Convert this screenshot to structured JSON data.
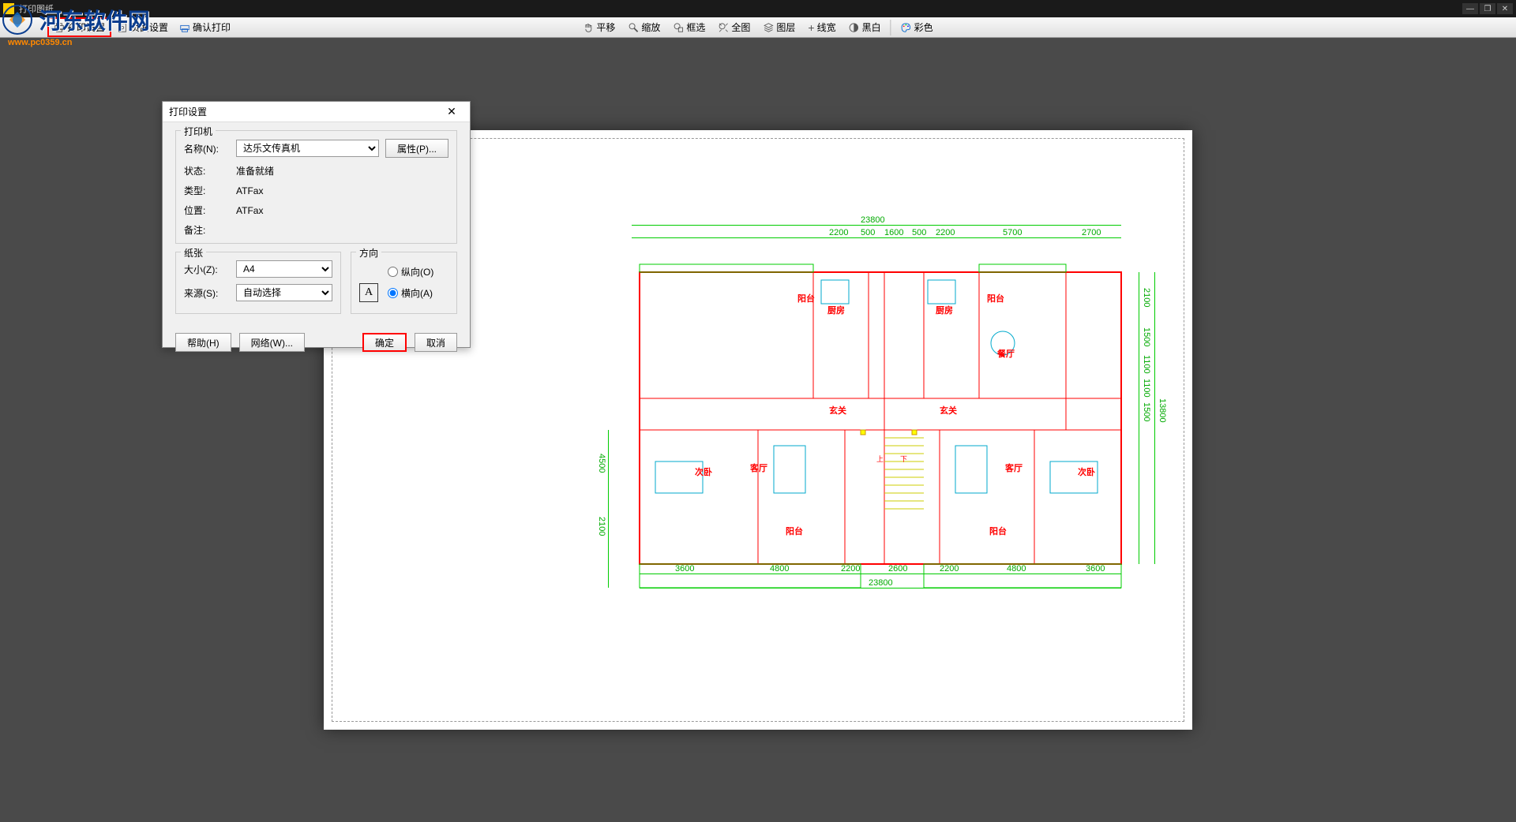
{
  "app": {
    "title": "打印图纸"
  },
  "watermark": {
    "text": "河东软件网",
    "url": "www.pc0359.cn"
  },
  "toolbar": {
    "print_settings": "打印设置",
    "page_settings": "页面设置",
    "confirm_print": "确认打印",
    "pan": "平移",
    "zoom": "缩放",
    "window": "框选",
    "extents": "全图",
    "layers": "图层",
    "lineweight": "线宽",
    "blackwhite": "黑白",
    "color": "彩色"
  },
  "dialog": {
    "title": "打印设置",
    "printer_group": "打印机",
    "name_label": "名称(N):",
    "name_value": "达乐文传真机",
    "properties_btn": "属性(P)...",
    "status_label": "状态:",
    "status_value": "准备就绪",
    "type_label": "类型:",
    "type_value": "ATFax",
    "location_label": "位置:",
    "location_value": "ATFax",
    "comment_label": "备注:",
    "comment_value": "",
    "paper_group": "纸张",
    "size_label": "大小(Z):",
    "size_value": "A4",
    "source_label": "来源(S):",
    "source_value": "自动选择",
    "orient_group": "方向",
    "portrait": "纵向(O)",
    "landscape": "横向(A)",
    "help_btn": "帮助(H)",
    "network_btn": "网络(W)...",
    "ok_btn": "确定",
    "cancel_btn": "取消"
  },
  "plan": {
    "dims_top_total": "23800",
    "dims_top": [
      "2200",
      "500",
      "1600",
      "500",
      "2200",
      "5700",
      "2700"
    ],
    "dims_bottom_total": "23800",
    "dims_bottom": [
      "3600",
      "4800",
      "2200",
      "2600",
      "2200",
      "4800",
      "3600"
    ],
    "dims_right": [
      "2100",
      "1500",
      "1100",
      "1100",
      "1500",
      "13800"
    ],
    "dims_left": [
      "4500",
      "2100"
    ],
    "rooms": {
      "balcony1": "阳台",
      "balcony2": "阳台",
      "balcony3": "阳台",
      "balcony4": "阳台",
      "kitchen1": "厨房",
      "kitchen2": "厨房",
      "dining": "餐厅",
      "dining2": "厅",
      "entrance1": "玄关",
      "entrance2": "玄关",
      "living1": "客厅",
      "living2": "客厅",
      "bedroom1": "次卧",
      "bedroom2": "次卧",
      "stairs_up": "上",
      "stairs_down": "下"
    }
  }
}
